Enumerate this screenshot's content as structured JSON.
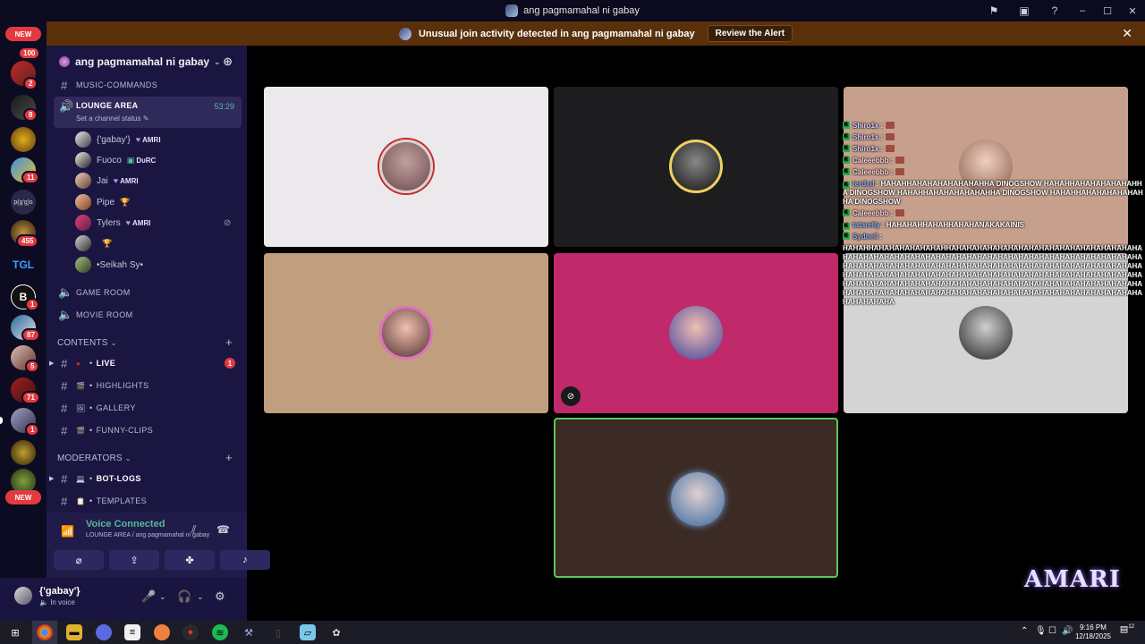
{
  "window": {
    "title": "ang pagmamahal ni gabay",
    "controls": {
      "minimize": "–",
      "maximize": "☐",
      "close": "✕"
    }
  },
  "alert": {
    "text": "Unusual join activity detected in ang pagmamahal ni gabay",
    "button": "Review the Alert",
    "close": "✕"
  },
  "rail": {
    "new_top": "NEW",
    "new_bottom": "NEW",
    "badges": [
      "100",
      "2",
      "8",
      "11",
      "455",
      "1",
      "87",
      "5",
      "71",
      "1"
    ],
    "text_server": "p(g'g)s"
  },
  "server": {
    "name": "ang pagmamahal ni gabay"
  },
  "channels": {
    "music": "MUSIC-COMMANDS",
    "lounge": {
      "name": "LOUNGE AREA",
      "time": "53:29",
      "status": "Set a channel status"
    },
    "game": "GAME ROOM",
    "movie": "MOVIE ROOM"
  },
  "voice_users": [
    {
      "name": "{'gabay'}",
      "tag": "AMRI",
      "tag_icon": "heart"
    },
    {
      "name": "Fuoco",
      "tag": "DυRC",
      "tag_icon": "badge"
    },
    {
      "name": "Jai",
      "tag": "AMRI",
      "tag_icon": "heart"
    },
    {
      "name": "Pipe",
      "tag": "",
      "tag_icon": "trophy"
    },
    {
      "name": "Tylers",
      "tag": "AMRI",
      "tag_icon": "heart"
    },
    {
      "name": "",
      "tag": "",
      "tag_icon": "trophy"
    },
    {
      "name": "•Seikah Sy•",
      "tag": "",
      "tag_icon": ""
    }
  ],
  "categories": {
    "contents": "CONTENTS",
    "moderators": "MODERATORS"
  },
  "content_channels": [
    {
      "name": "LIVE",
      "badge": "1"
    },
    {
      "name": "HIGHLIGHTS"
    },
    {
      "name": "GALLERY"
    },
    {
      "name": "FUNNY-CLIPS"
    }
  ],
  "mod_channels": [
    {
      "name": "BOT-LOGS"
    },
    {
      "name": "TEMPLATES"
    }
  ],
  "voice_panel": {
    "title": "Voice Connected",
    "subtitle": "LOUNGE AREA / ang pagmamahal ni gabay"
  },
  "user_panel": {
    "name": "{'gabay'}",
    "status": "In voice"
  },
  "tile_colors": [
    "#ece9ec",
    "#1d1d1f",
    "#c6a08c",
    "#c19e7d",
    "#c0296a",
    "#d4d4d4",
    "#3c2a24"
  ],
  "overlay": {
    "lines": [
      {
        "name": "Shiro1x",
        "text": ""
      },
      {
        "name": "Shiro1x",
        "text": ""
      },
      {
        "name": "Shiro1x",
        "text": ""
      },
      {
        "name": "Caleeebbb",
        "text": ""
      },
      {
        "name": "Caleeebbb",
        "text": ""
      },
      {
        "name": "terdxd",
        "text": "HAHAHHAHAHAHAHAHAHAHHA DINOGSHOW HAHAHHAHAHAHAHAHAHHA DINOGSHOW HAHAHHAHAHAHAHAHAHHA DINOGSHOW HAHAHHAHAHAHAHAHAHHA DINOGSHOW"
      },
      {
        "name": "Caleeebbb",
        "text": ""
      },
      {
        "name": "tatarelly",
        "text": "HAHAHAHHAHAHHAHAHANAKAKAINIS"
      },
      {
        "name": "Sydnell",
        "text": ""
      }
    ],
    "block": "HAHAHHAHAHAHAHAHAHAHHAHAHAHAHAHAHAHAHAHAHAHAHAHAHAHAHAHAHAHAHAHAHAHAHAHAHAHAHAHAHAHAHAHAHAHAHAHAHAHAHAHAHAHAHAHAHAHAHAHAHAHAHAHAHAHAHAHAHAHAHAHAHAHAHAHAHAHAHAHAHAHAHAHAHAHAHAHAHAHAHAHAHAHAHAHAHAHAHAHAHAHAHAHAHAHAHAHAHAHAHAHAHAHAHAHAHAHAHAHAHAHAHAHAHAHAHAHAHAHAHAHAHAHAHAHAHAHAHAHAHAHAHAHAHAHAHAHAHAHAHAHAHAHAHAHAHAHAHAHAHAHAHAHAHAHAHAHAHAHAHAHAHAHAHAHAHAHAHA"
  },
  "watermark": "AMARI",
  "taskbar": {
    "time": "9:16 PM",
    "date": "12/18/2025",
    "notify": "12"
  }
}
